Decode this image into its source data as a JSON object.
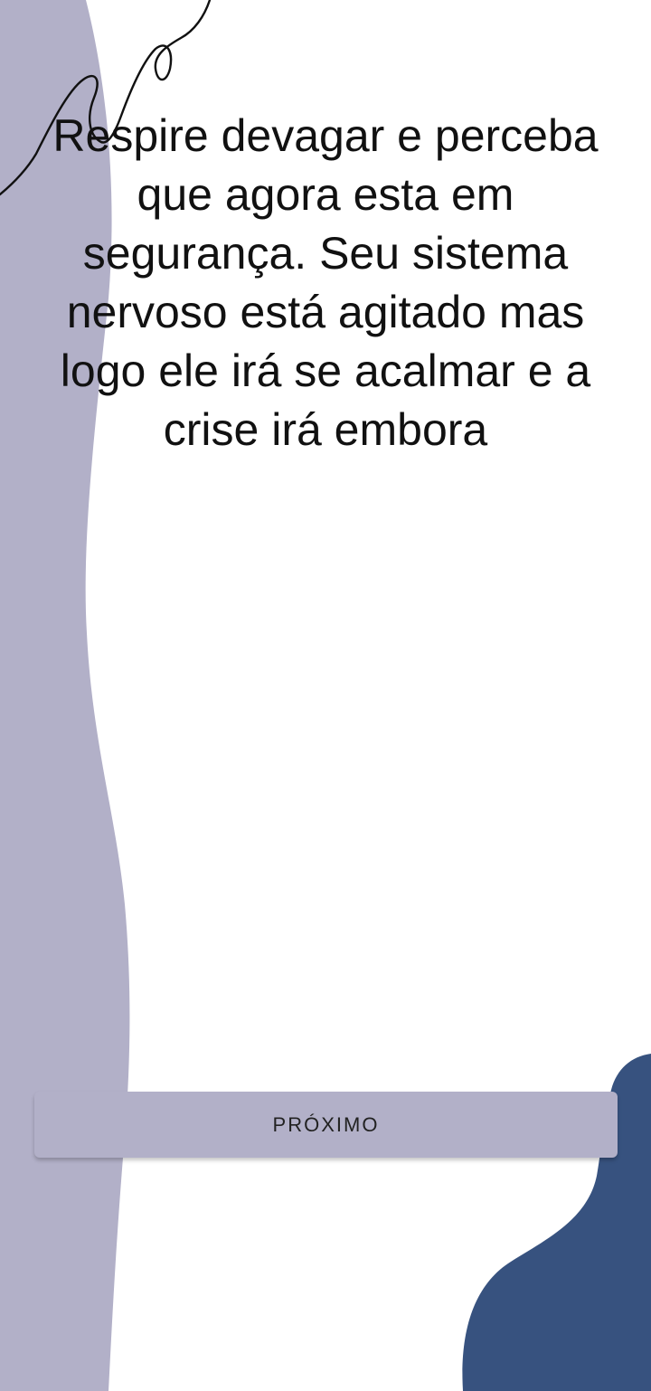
{
  "content": {
    "message": "Respire devagar e perceba que agora esta em segurança. Seu sistema nervoso está agitado mas logo ele irá se acalmar e a crise irá embora"
  },
  "actions": {
    "next_label": "PRÓXIMO"
  },
  "colors": {
    "background": "#ffffff",
    "left_blob": "#b2b0c8",
    "corner_blob": "#37527f",
    "button": "#b2b0c8",
    "text": "#111111"
  },
  "decor_icons": [
    "left-lavender-blob",
    "corner-navy-blob",
    "handwritten-swirl"
  ]
}
